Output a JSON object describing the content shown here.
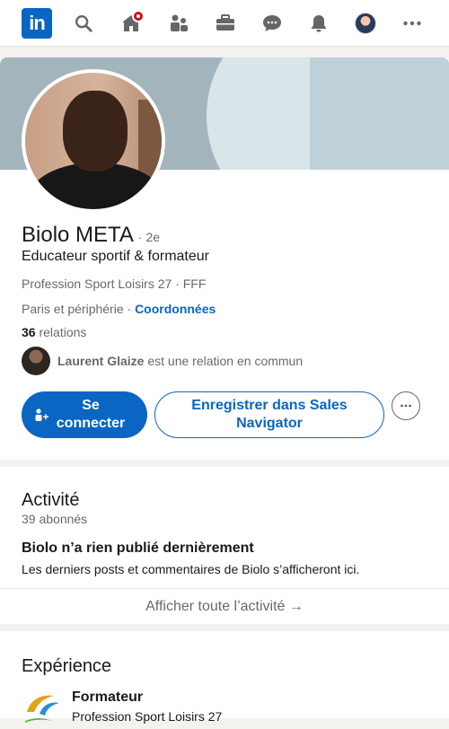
{
  "nav": {
    "logo_text": "in",
    "items": [
      "search-icon",
      "home-icon",
      "network-icon",
      "jobs-icon",
      "messaging-icon",
      "notifications-icon",
      "profile-avatar",
      "more-icon"
    ]
  },
  "profile": {
    "name": "Biolo META",
    "degree": "· 2e",
    "headline": "Educateur sportif & formateur",
    "company": "Profession Sport Loisirs 27 · FFF",
    "location": "Paris et périphérie · ",
    "contact_link": "Coordonnées",
    "relations_count": "36",
    "relations_label": " relations",
    "mutual_name": "Laurent Glaize",
    "mutual_suffix": " est une relation en commun",
    "connect_label": "Se connecter",
    "sales_nav_label": "Enregistrer dans Sales Navigator"
  },
  "activity": {
    "title": "Activité",
    "followers": "39 abonnés",
    "empty_title": "Biolo n’a rien publié dernièrement",
    "empty_desc": "Les derniers posts et commentaires de Biolo s’afficheront ici.",
    "show_all": "Afficher toute l’activité →"
  },
  "experience": {
    "title": "Expérience",
    "items": [
      {
        "title": "Formateur",
        "company": "Profession Sport Loisirs 27"
      }
    ]
  },
  "colors": {
    "brand": "#0a66c2",
    "notification": "#cc1016"
  }
}
